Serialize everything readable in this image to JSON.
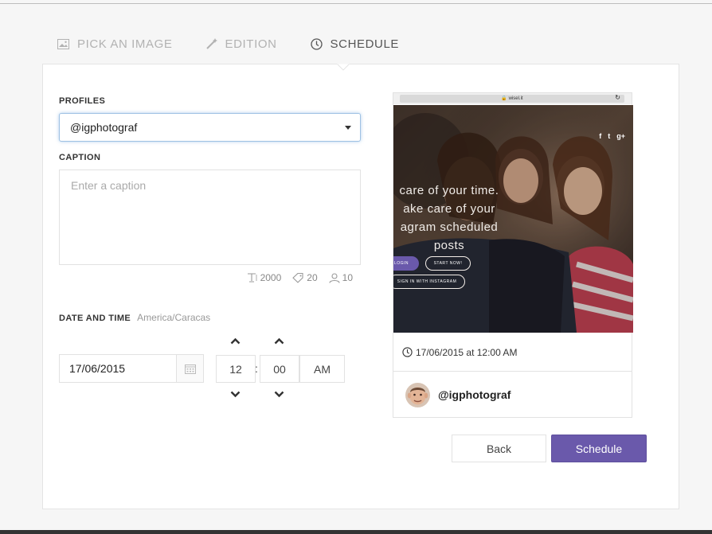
{
  "wizard": {
    "steps": [
      {
        "label": "PICK AN IMAGE",
        "icon": "image-icon",
        "active": false
      },
      {
        "label": "EDITION",
        "icon": "magic-wand-icon",
        "active": false
      },
      {
        "label": "SCHEDULE",
        "icon": "clock-icon",
        "active": true
      }
    ]
  },
  "form": {
    "profiles_label": "PROFILES",
    "profile_selected": "@igphotograf",
    "caption_label": "CAPTION",
    "caption_placeholder": "Enter a caption",
    "caption_value": "",
    "counters": {
      "characters": "2000",
      "hashtags": "20",
      "mentions": "10"
    },
    "datetime_label": "DATE AND TIME",
    "timezone": "America/Caracas",
    "date": "17/06/2015",
    "hour": "12",
    "separator": ":",
    "minute": "00",
    "meridiem": "AM"
  },
  "preview": {
    "browser_url": "wisel.it",
    "hero_lines": [
      "care of your time.",
      "ake care of your",
      "agram scheduled",
      "posts"
    ],
    "social": [
      "f",
      "t",
      "g+"
    ],
    "buttons": {
      "login": "LOGIN",
      "start": "START NOW!",
      "signin": "SIGN IN WITH INSTAGRAM"
    },
    "schedule_text": "17/06/2015 at 12:00 AM",
    "profile_name": "@igphotograf"
  },
  "actions": {
    "back": "Back",
    "schedule": "Schedule"
  },
  "colors": {
    "accent": "#6a59ab",
    "focus_border": "#9ec1e3",
    "muted_text": "#b2b2b2"
  }
}
